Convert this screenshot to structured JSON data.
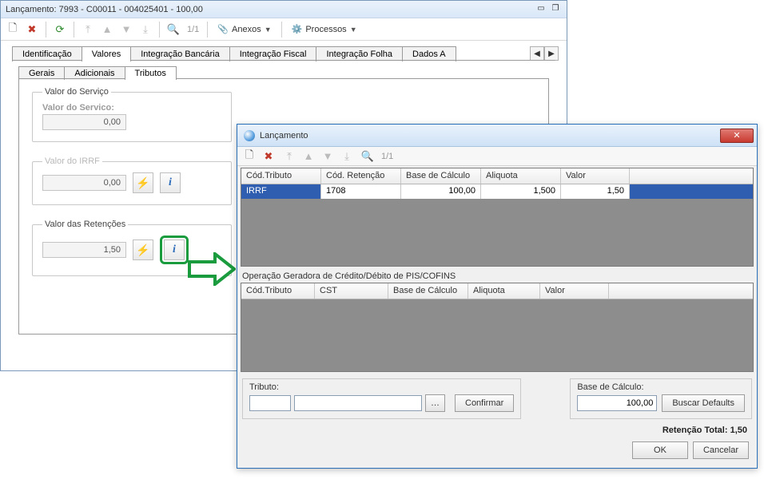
{
  "main": {
    "title": "Lançamento: 7993 - C00011 - 004025401 - 100,00",
    "toolbar": {
      "pager": "1/1",
      "anexos": "Anexos",
      "processos": "Processos"
    },
    "tabs": [
      "Identificação",
      "Valores",
      "Integração Bancária",
      "Integração Fiscal",
      "Integração Folha",
      "Dados A"
    ],
    "activeTabIndex": 1,
    "subtabs": [
      "Gerais",
      "Adicionais",
      "Tributos"
    ],
    "activeSubtabIndex": 2,
    "groups": {
      "servico": {
        "legend": "Valor do Serviço",
        "label": "Valor do Servico:",
        "value": "0,00"
      },
      "irrf": {
        "legend": "Valor do IRRF",
        "value": "0,00"
      },
      "retenc": {
        "legend": "Valor das Retenções",
        "value": "1,50"
      }
    }
  },
  "dialog": {
    "title": "Lançamento",
    "toolbar_pager": "1/1",
    "grid1": {
      "headers": [
        "Cód.Tributo",
        "Cód. Retenção",
        "Base de Cálculo",
        "Aliquota",
        "Valor"
      ],
      "rows": [
        {
          "codTributo": "IRRF",
          "codRetencao": "1708",
          "base": "100,00",
          "aliquota": "1,500",
          "valor": "1,50"
        }
      ]
    },
    "sectionLabel": "Operação Geradora de Crédito/Débito de PIS/COFINS",
    "grid2": {
      "headers": [
        "Cód.Tributo",
        "CST",
        "Base de Cálculo",
        "Aliquota",
        "Valor"
      ]
    },
    "tributo": {
      "label": "Tributo:",
      "code": "",
      "desc": ""
    },
    "confirmar": "Confirmar",
    "base": {
      "label": "Base de Cálculo:",
      "value": "100,00"
    },
    "buscar": "Buscar Defaults",
    "totalLabel": "Retenção Total:",
    "totalValue": "1,50",
    "ok": "OK",
    "cancel": "Cancelar"
  }
}
